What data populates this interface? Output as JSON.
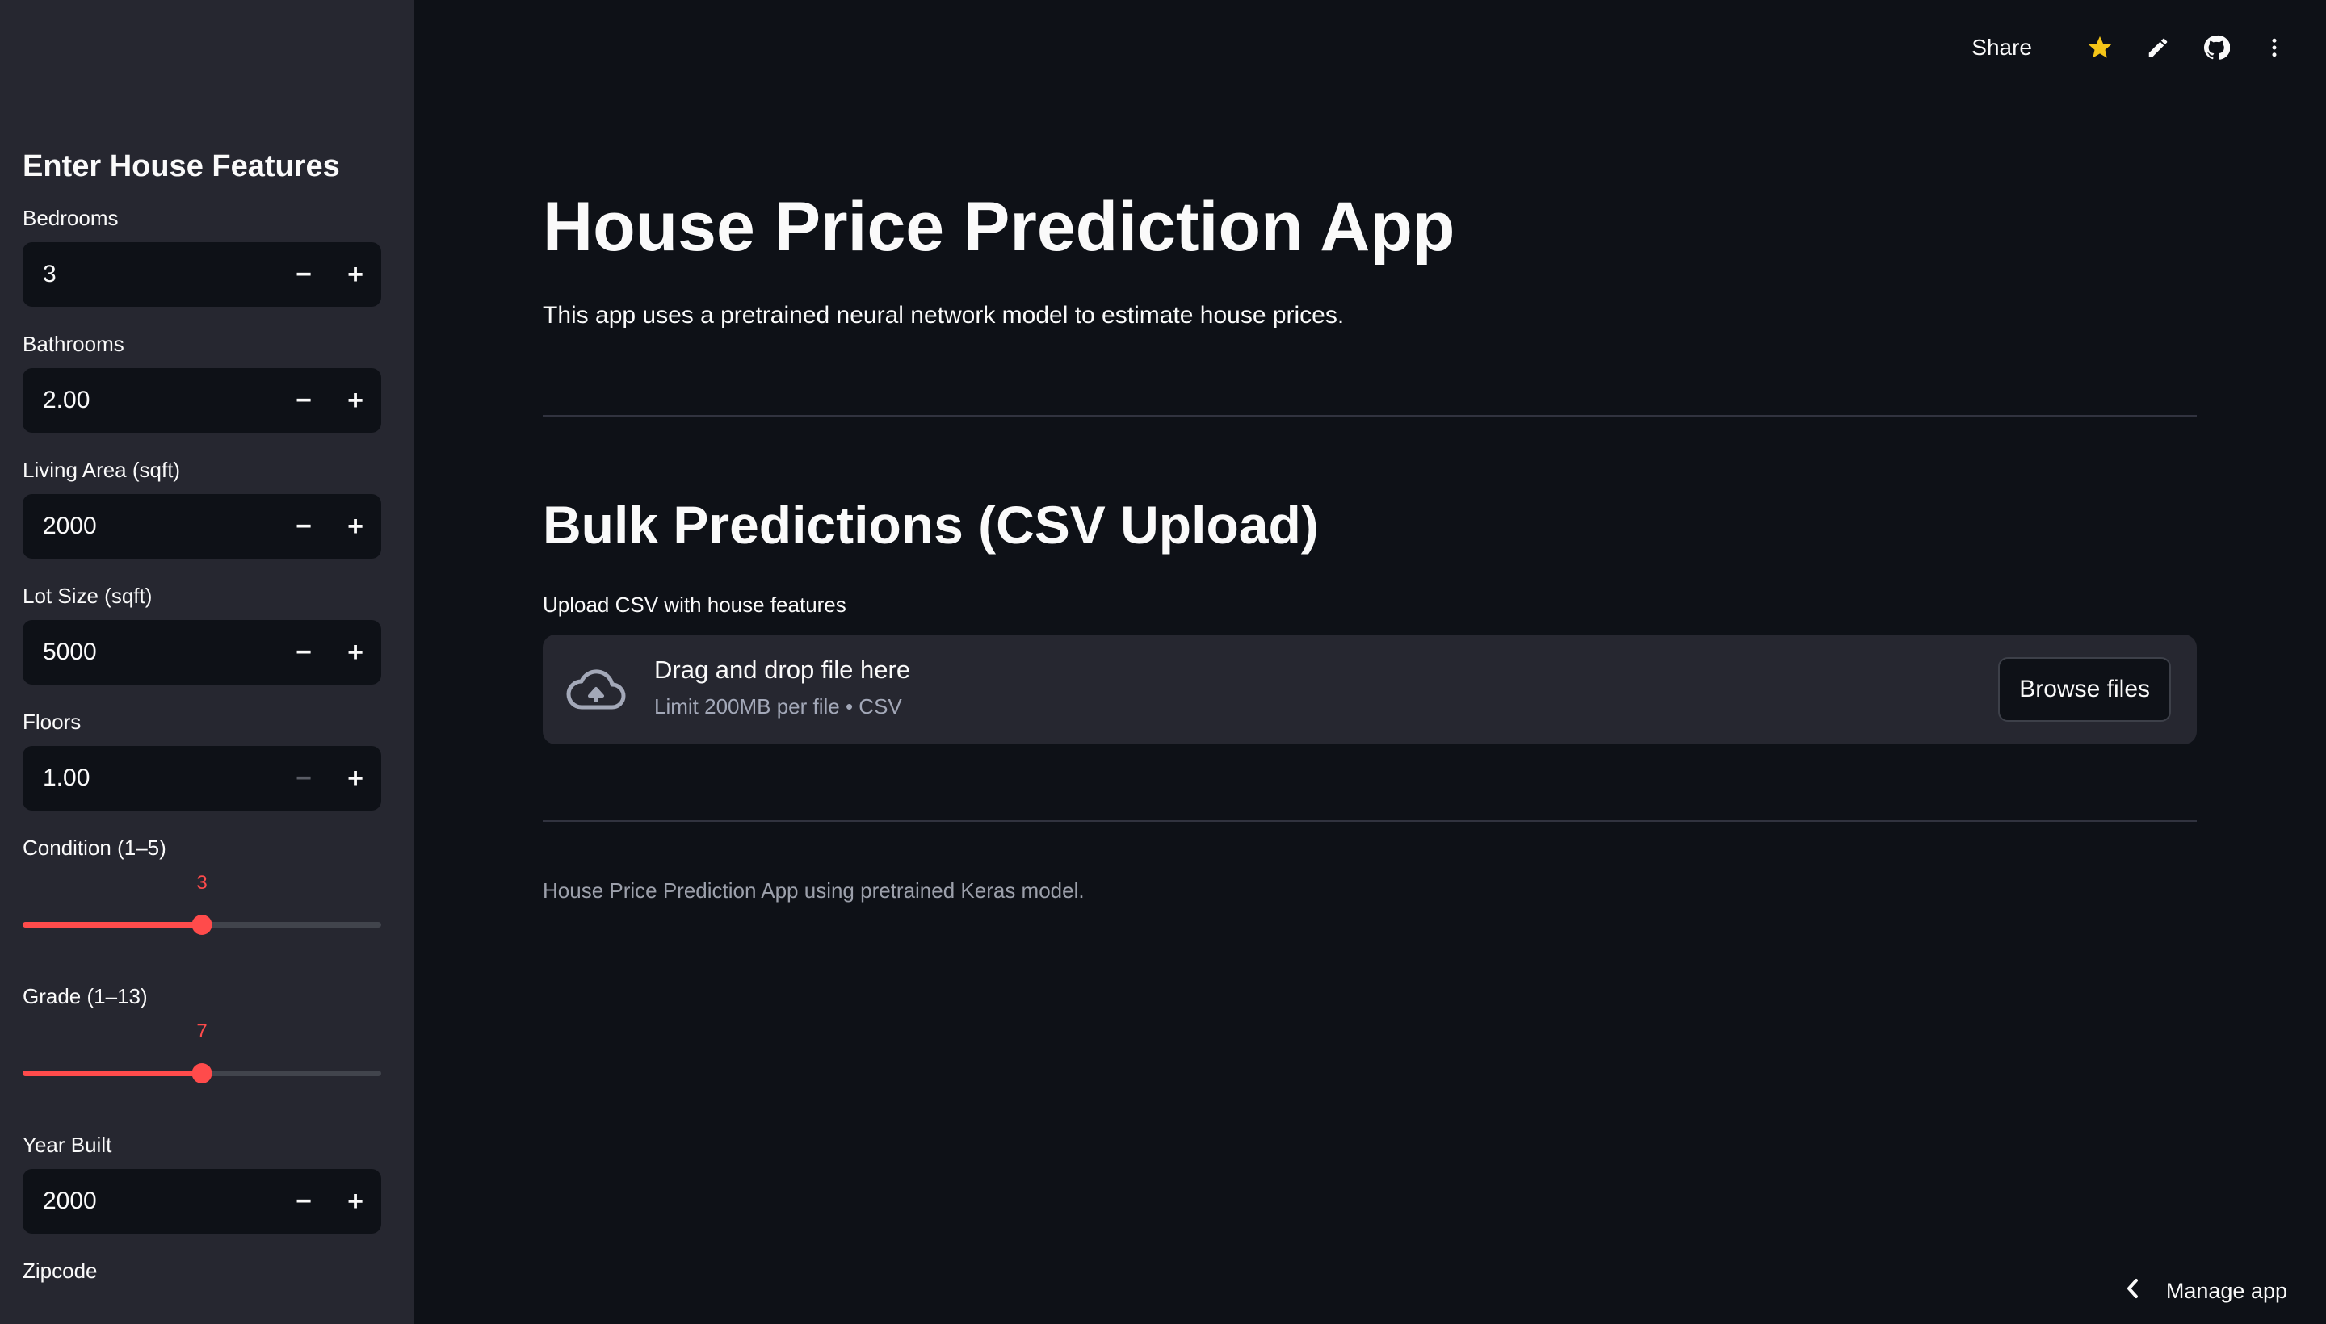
{
  "sidebar": {
    "title": "Enter House Features",
    "bedrooms": {
      "label": "Bedrooms",
      "value": "3"
    },
    "bathrooms": {
      "label": "Bathrooms",
      "value": "2.00"
    },
    "living_area": {
      "label": "Living Area (sqft)",
      "value": "2000"
    },
    "lot_size": {
      "label": "Lot Size (sqft)",
      "value": "5000"
    },
    "floors": {
      "label": "Floors",
      "value": "1.00"
    },
    "condition": {
      "label": "Condition (1–5)",
      "value": "3",
      "min": 1,
      "max": 5,
      "current": 3
    },
    "grade": {
      "label": "Grade (1–13)",
      "value": "7",
      "min": 1,
      "max": 13,
      "current": 7
    },
    "year_built": {
      "label": "Year Built",
      "value": "2000"
    },
    "zipcode": {
      "label": "Zipcode"
    },
    "minus_symbol": "−",
    "plus_symbol": "+"
  },
  "topbar": {
    "share_label": "Share",
    "icons": [
      "star-icon",
      "edit-icon",
      "github-icon",
      "more-vertical-icon"
    ]
  },
  "main": {
    "title": "House Price Prediction App",
    "description": "This app uses a pretrained neural network model to estimate house prices.",
    "bulk_title": "Bulk Predictions (CSV Upload)",
    "upload_label": "Upload CSV with house features",
    "dropzone_main": "Drag and drop file here",
    "dropzone_sub": "Limit 200MB per file • CSV",
    "browse_label": "Browse files",
    "caption": "House Price Prediction App using pretrained Keras model."
  },
  "footer": {
    "manage_label": "Manage app"
  },
  "colors": {
    "accent": "#ff4b4b",
    "background": "#0e1117",
    "sidebar_bg": "#262730",
    "star": "#f5c518"
  }
}
